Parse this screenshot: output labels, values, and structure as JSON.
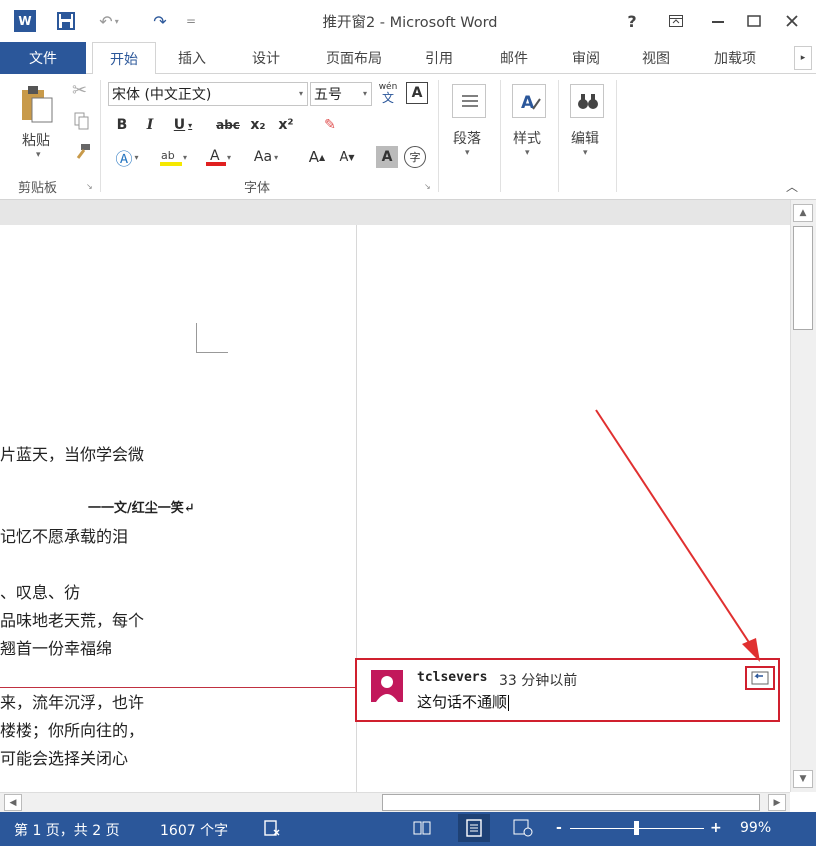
{
  "window": {
    "title": "推开窗2 - Microsoft Word",
    "app_icon": "W",
    "help": "?",
    "colors": {
      "brand": "#2b579a",
      "comment_border": "#d0202e",
      "arrow": "#e03030"
    }
  },
  "tabs": [
    "文件",
    "开始",
    "插入",
    "设计",
    "页面布局",
    "引用",
    "邮件",
    "审阅",
    "视图",
    "加载项"
  ],
  "ribbon": {
    "clipboard": {
      "paste": "粘贴",
      "group": "剪贴板"
    },
    "font": {
      "font_name": "宋体 (中文正文)",
      "font_size": "五号",
      "pinyin": "wén",
      "pinyin_char": "文",
      "border_char": "A",
      "bold": "B",
      "italic": "I",
      "underline": "U",
      "strike": "abc",
      "sub": "x₂",
      "sup": "x²",
      "change_case": "Aa",
      "grow": "A",
      "shrink": "A",
      "shade": "A",
      "enclose": "字",
      "group": "字体"
    },
    "paragraph": "段落",
    "styles": "样式",
    "editing": "编辑"
  },
  "document": {
    "lines": [
      "片蓝天，当你学会微",
      "一一文/红尘一笑↵",
      "记忆不愿承载的泪",
      "、叹息、彷",
      "品味地老天荒，每个",
      "翘首一份幸福绵",
      "来，流年沉浮，也许",
      "楼楼；你所向往的，",
      "可能会选择关闭心"
    ]
  },
  "comment": {
    "author": "tclsevers",
    "time": "33 分钟以前",
    "text": "这句话不通顺"
  },
  "status": {
    "page": "第 1 页，共 2 页",
    "words": "1607 个字",
    "zoom": "99%",
    "minus": "-",
    "plus": "+"
  }
}
